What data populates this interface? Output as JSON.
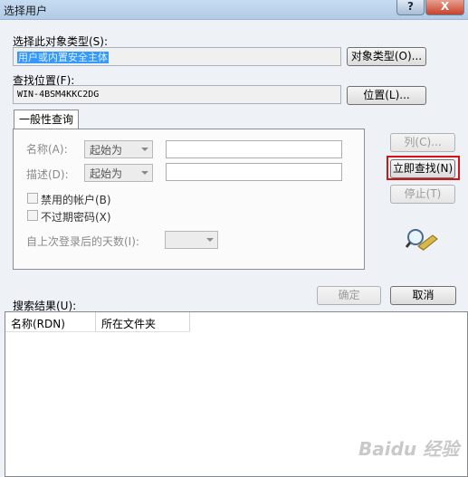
{
  "window": {
    "title": "选择用户",
    "help_glyph": "?",
    "close_glyph": "X"
  },
  "object_type": {
    "label": "选择此对象类型(S):",
    "value": "用户或内置安全主体",
    "button": "对象类型(O)..."
  },
  "location": {
    "label": "查找位置(F):",
    "value": "WIN-4BSM4KKC2DG",
    "button": "位置(L)..."
  },
  "tab": {
    "label": "一般性查询"
  },
  "query": {
    "name_label": "名称(A):",
    "name_mode": "起始为",
    "desc_label": "描述(D):",
    "desc_mode": "起始为",
    "disabled_accounts": "禁用的帐户(B)",
    "non_expiring_pw": "不过期密码(X)",
    "days_since_login": "自上次登录后的天数(I):"
  },
  "side_buttons": {
    "columns": "列(C)...",
    "find_now": "立即查找(N)",
    "stop": "停止(T)"
  },
  "footer": {
    "ok": "确定",
    "cancel": "取消"
  },
  "results": {
    "label": "搜索结果(U):",
    "columns": [
      "名称(RDN)",
      "所在文件夹"
    ]
  },
  "watermark": "Baidu 经验",
  "icons": {
    "search": "magnifier-icon"
  }
}
